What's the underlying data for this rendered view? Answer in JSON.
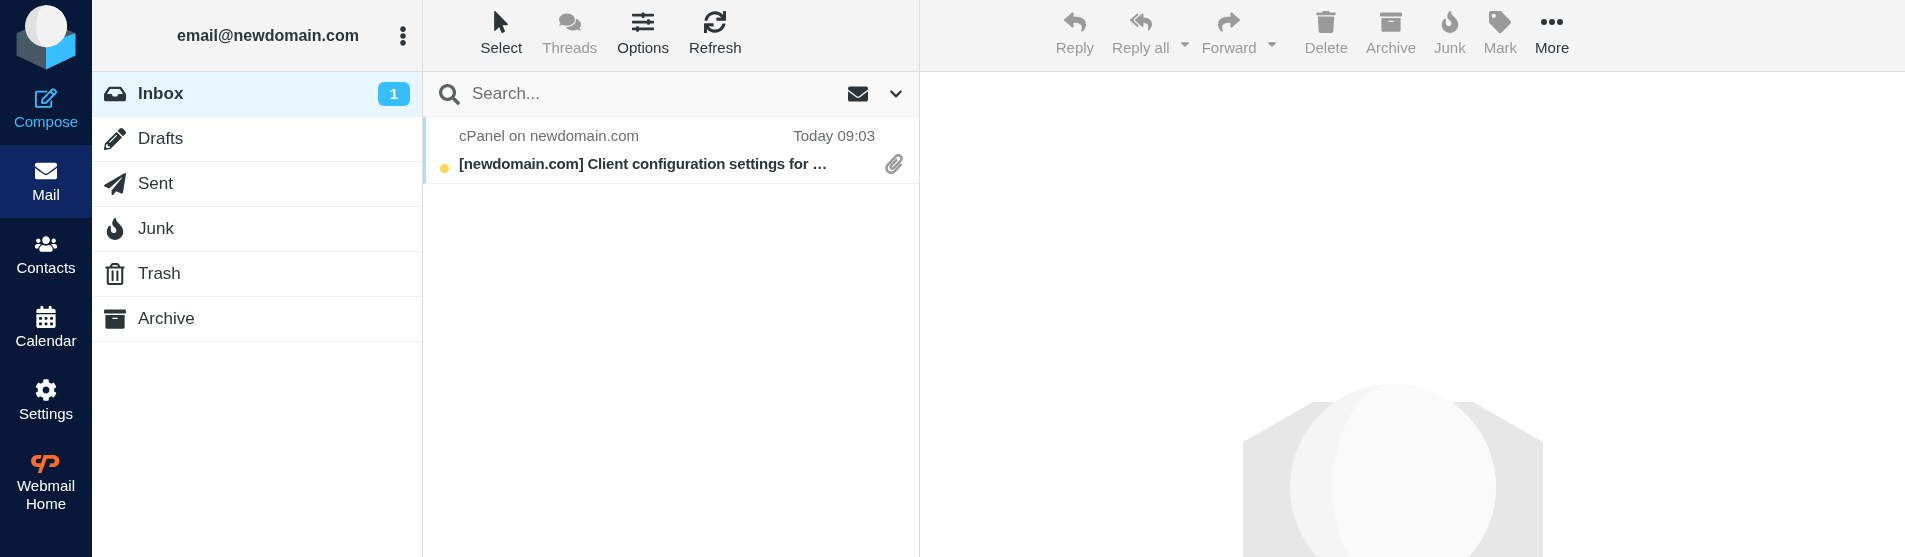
{
  "nav": [
    {
      "label": "Compose",
      "selected": false,
      "kind": "compose"
    },
    {
      "label": "Mail",
      "selected": true,
      "kind": "mail"
    },
    {
      "label": "Contacts",
      "selected": false,
      "kind": "contacts"
    },
    {
      "label": "Calendar",
      "selected": false,
      "kind": "calendar"
    },
    {
      "label": "Settings",
      "selected": false,
      "kind": "settings"
    },
    {
      "label": "Webmail Home",
      "selected": false,
      "kind": "home"
    }
  ],
  "account": {
    "email": "email@newdomain.com"
  },
  "folders": [
    {
      "label": "Inbox",
      "selected": true,
      "unread": "1"
    },
    {
      "label": "Drafts",
      "selected": false
    },
    {
      "label": "Sent",
      "selected": false
    },
    {
      "label": "Junk",
      "selected": false
    },
    {
      "label": "Trash",
      "selected": false
    },
    {
      "label": "Archive",
      "selected": false
    }
  ],
  "list_toolbar": [
    {
      "label": "Select",
      "disabled": false
    },
    {
      "label": "Threads",
      "disabled": true
    },
    {
      "label": "Options",
      "disabled": false
    },
    {
      "label": "Refresh",
      "disabled": false
    }
  ],
  "search": {
    "placeholder": "Search..."
  },
  "messages": [
    {
      "from": "cPanel on newdomain.com",
      "date": "Today 09:03",
      "subject": "[newdomain.com] Client configuration settings for …",
      "unread": true,
      "attachment": true,
      "selected": true
    }
  ],
  "message_toolbar": [
    {
      "label": "Reply",
      "disabled": true,
      "dropdown": false
    },
    {
      "label": "Reply all",
      "disabled": true,
      "dropdown": true
    },
    {
      "label": "Forward",
      "disabled": true,
      "dropdown": true
    },
    {
      "label": "Delete",
      "disabled": true,
      "dropdown": false
    },
    {
      "label": "Archive",
      "disabled": true,
      "dropdown": false
    },
    {
      "label": "Junk",
      "disabled": true,
      "dropdown": false
    },
    {
      "label": "Mark",
      "disabled": true,
      "dropdown": false
    },
    {
      "label": "More",
      "disabled": false,
      "dropdown": false
    }
  ]
}
